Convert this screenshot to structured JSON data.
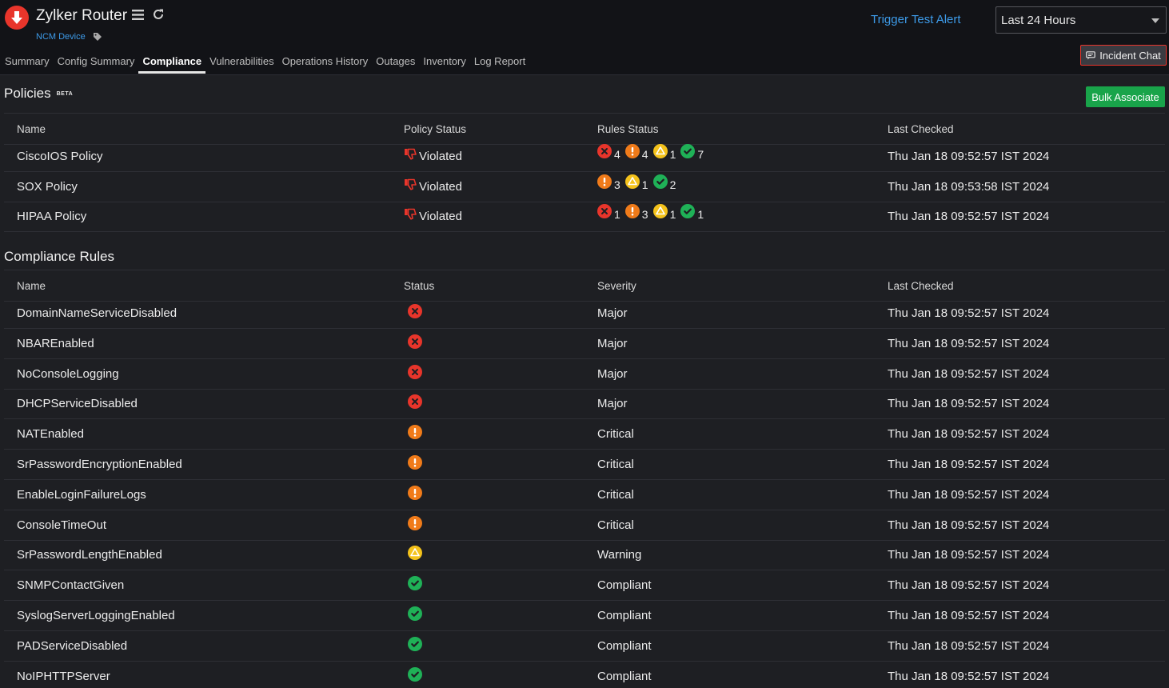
{
  "header": {
    "device_name": "Zylker Router",
    "device_type": "NCM Device",
    "trigger_alert": "Trigger Test Alert",
    "time_range": "Last 24 Hours",
    "incident_chat": "Incident Chat",
    "tabs": [
      "Summary",
      "Config Summary",
      "Compliance",
      "Vulnerabilities",
      "Operations History",
      "Outages",
      "Inventory",
      "Log Report"
    ],
    "active_tab": "Compliance"
  },
  "colors": {
    "violation": "#e8352b",
    "critical": "#f07b1a",
    "warning": "#f4c21b",
    "compliant": "#1fb157",
    "link": "#3d9be9",
    "button_green": "#19a44a"
  },
  "policies": {
    "title": "Policies",
    "badge": "BETA",
    "bulk_associate": "Bulk Associate",
    "columns": [
      "Name",
      "Policy Status",
      "Rules Status",
      "Last Checked"
    ],
    "rows": [
      {
        "name": "CiscoIOS Policy",
        "status": "Violated",
        "rules": [
          {
            "type": "violation",
            "count": "4"
          },
          {
            "type": "critical",
            "count": "4"
          },
          {
            "type": "warning",
            "count": "1"
          },
          {
            "type": "compliant",
            "count": "7"
          }
        ],
        "last_checked": "Thu Jan 18 09:52:57 IST 2024"
      },
      {
        "name": "SOX Policy",
        "status": "Violated",
        "rules": [
          {
            "type": "critical",
            "count": "3"
          },
          {
            "type": "warning",
            "count": "1"
          },
          {
            "type": "compliant",
            "count": "2"
          }
        ],
        "last_checked": "Thu Jan 18 09:53:58 IST 2024"
      },
      {
        "name": "HIPAA Policy",
        "status": "Violated",
        "rules": [
          {
            "type": "violation",
            "count": "1"
          },
          {
            "type": "critical",
            "count": "3"
          },
          {
            "type": "warning",
            "count": "1"
          },
          {
            "type": "compliant",
            "count": "1"
          }
        ],
        "last_checked": "Thu Jan 18 09:52:57 IST 2024"
      }
    ]
  },
  "rules": {
    "title": "Compliance Rules",
    "columns": [
      "Name",
      "Status",
      "Severity",
      "Last Checked"
    ],
    "rows": [
      {
        "name": "DomainNameServiceDisabled",
        "status": "violation",
        "severity": "Major",
        "last_checked": "Thu Jan 18 09:52:57 IST 2024"
      },
      {
        "name": "NBAREnabled",
        "status": "violation",
        "severity": "Major",
        "last_checked": "Thu Jan 18 09:52:57 IST 2024"
      },
      {
        "name": "NoConsoleLogging",
        "status": "violation",
        "severity": "Major",
        "last_checked": "Thu Jan 18 09:52:57 IST 2024"
      },
      {
        "name": "DHCPServiceDisabled",
        "status": "violation",
        "severity": "Major",
        "last_checked": "Thu Jan 18 09:52:57 IST 2024"
      },
      {
        "name": "NATEnabled",
        "status": "critical",
        "severity": "Critical",
        "last_checked": "Thu Jan 18 09:52:57 IST 2024"
      },
      {
        "name": "SrPasswordEncryptionEnabled",
        "status": "critical",
        "severity": "Critical",
        "last_checked": "Thu Jan 18 09:52:57 IST 2024"
      },
      {
        "name": "EnableLoginFailureLogs",
        "status": "critical",
        "severity": "Critical",
        "last_checked": "Thu Jan 18 09:52:57 IST 2024"
      },
      {
        "name": "ConsoleTimeOut",
        "status": "critical",
        "severity": "Critical",
        "last_checked": "Thu Jan 18 09:52:57 IST 2024"
      },
      {
        "name": "SrPasswordLengthEnabled",
        "status": "warning",
        "severity": "Warning",
        "last_checked": "Thu Jan 18 09:52:57 IST 2024"
      },
      {
        "name": "SNMPContactGiven",
        "status": "compliant",
        "severity": "Compliant",
        "last_checked": "Thu Jan 18 09:52:57 IST 2024"
      },
      {
        "name": "SyslogServerLoggingEnabled",
        "status": "compliant",
        "severity": "Compliant",
        "last_checked": "Thu Jan 18 09:52:57 IST 2024"
      },
      {
        "name": "PADServiceDisabled",
        "status": "compliant",
        "severity": "Compliant",
        "last_checked": "Thu Jan 18 09:52:57 IST 2024"
      },
      {
        "name": "NoIPHTTPServer",
        "status": "compliant",
        "severity": "Compliant",
        "last_checked": "Thu Jan 18 09:52:57 IST 2024"
      }
    ]
  }
}
